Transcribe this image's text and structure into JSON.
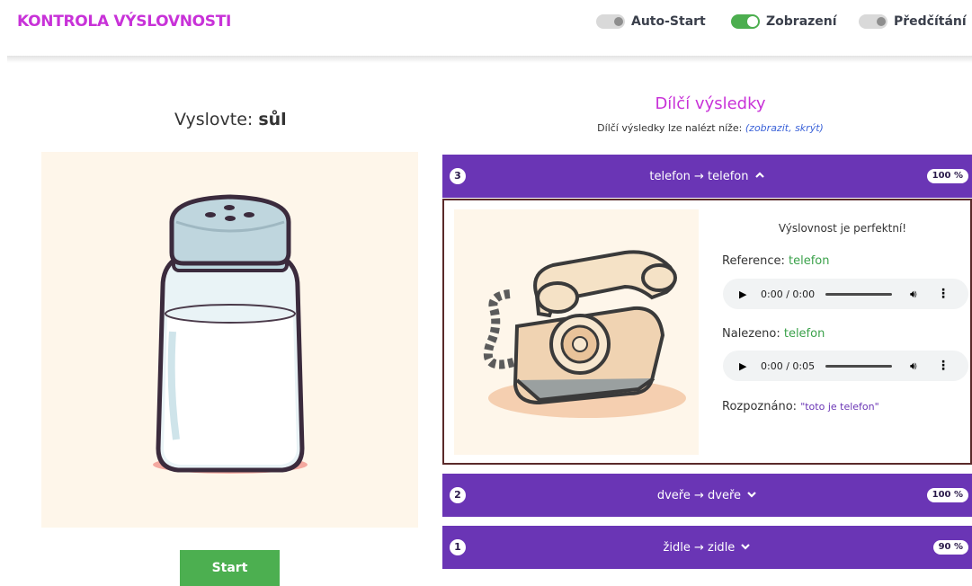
{
  "header": {
    "title": "KONTROLA VÝSLOVNOSTI",
    "toggles": [
      {
        "label": "Auto-Start",
        "state": "off"
      },
      {
        "label": "Zobrazení",
        "state": "on"
      },
      {
        "label": "Předčítání",
        "state": "off"
      }
    ]
  },
  "practice": {
    "prompt_label": "Vyslovte:",
    "word": "sůl",
    "image_icon": "salt-shaker-illustration",
    "start_label": "Start"
  },
  "results": {
    "title": "Dílčí výsledky",
    "subtitle": "Dílčí výsledky lze nalézt níže:",
    "toggle_link": "(zobrazit, skrýt)",
    "items": [
      {
        "number": "3",
        "title": "telefon → telefon",
        "chevron": "chevron-up-icon",
        "score": "100 %",
        "expanded": true
      },
      {
        "number": "2",
        "title": "dveře → dveře",
        "chevron": "chevron-down-icon",
        "score": "100 %",
        "expanded": false
      },
      {
        "number": "1",
        "title": "židle → zidle",
        "chevron": "chevron-down-icon",
        "score": "90 %",
        "expanded": false
      }
    ],
    "detail": {
      "image_icon": "rotary-telephone-illustration",
      "verdict": "Výslovnost je perfektní!",
      "reference_label": "Reference:",
      "reference_value": "telefon",
      "reference_audio_time": "0:00 / 0:00",
      "found_label": "Nalezeno:",
      "found_value": "telefon",
      "found_audio_time": "0:00 / 0:05",
      "recognized_label": "Rozpoznáno:",
      "recognized_value": "\"toto je telefon\""
    }
  },
  "colors": {
    "accent_pink": "#c832d8",
    "accent_purple": "#6a35b5",
    "success_green": "#4caf50"
  }
}
